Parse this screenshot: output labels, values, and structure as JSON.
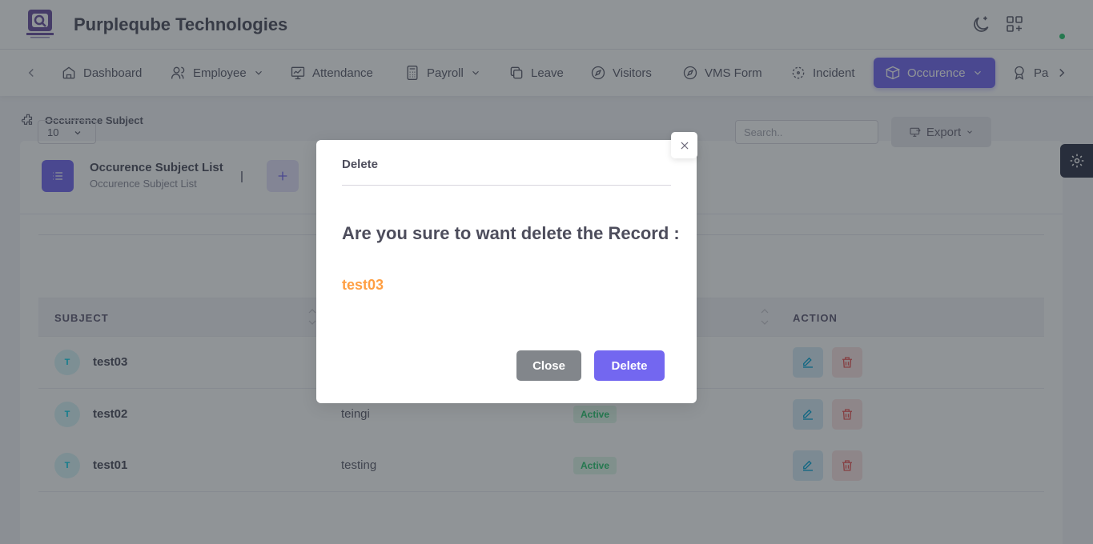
{
  "header": {
    "company": "Purpleqube Technologies"
  },
  "nav": {
    "items": [
      {
        "label": "Dashboard",
        "icon": "home-icon"
      },
      {
        "label": "Employee",
        "icon": "users-icon",
        "dropdown": true
      },
      {
        "label": "Attendance",
        "icon": "monitor-icon"
      },
      {
        "label": "Payroll",
        "icon": "calculator-icon",
        "dropdown": true
      },
      {
        "label": "Leave",
        "icon": "copy-icon"
      },
      {
        "label": "Visitors",
        "icon": "compass-icon"
      },
      {
        "label": "VMS Form",
        "icon": "compass-icon"
      },
      {
        "label": "Incident",
        "icon": "scan-icon"
      },
      {
        "label": "Occurence",
        "icon": "box-icon",
        "dropdown": true,
        "active": true
      },
      {
        "label": "Pa",
        "icon": "award-icon"
      }
    ]
  },
  "breadcrumb": {
    "label": "Occurrence Subject"
  },
  "card": {
    "title": "Occurence Subject List",
    "subtitle": "Occurence Subject List"
  },
  "table": {
    "page_size": "10",
    "search_placeholder": "Search..",
    "export_label": "Export",
    "columns": {
      "subject": "SUBJECT",
      "action": "ACTION"
    },
    "rows": [
      {
        "initial": "T",
        "subject": "test03",
        "description": "",
        "status": ""
      },
      {
        "initial": "T",
        "subject": "test02",
        "description": "teingi",
        "status": "Active"
      },
      {
        "initial": "T",
        "subject": "test01",
        "description": "testing",
        "status": "Active"
      }
    ]
  },
  "modal": {
    "title": "Delete",
    "question": "Are you sure to want delete the Record :",
    "record": "test03",
    "close_label": "Close",
    "delete_label": "Delete"
  },
  "colors": {
    "primary": "#7367f0",
    "warning": "#ff9f43",
    "success": "#28c76f",
    "secondary": "#82868b"
  }
}
